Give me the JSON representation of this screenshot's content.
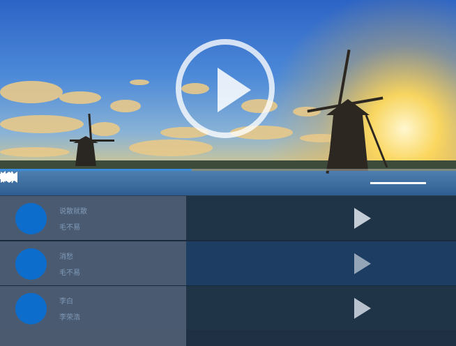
{
  "player": {
    "progress": 0.42,
    "volume": 1.0,
    "colors": {
      "progress": "#3a8bd8",
      "avatar": "#0d6dcc"
    },
    "icons": [
      "play-icon",
      "rewind-icon",
      "fast-forward-icon",
      "repeat-icon",
      "volume-low-icon",
      "volume-high-icon"
    ]
  },
  "playlist": [
    {
      "title": "说散就散",
      "artist": "毛不易"
    },
    {
      "title": "消愁",
      "artist": "毛不易"
    },
    {
      "title": "李白",
      "artist": "李荣浩"
    }
  ]
}
